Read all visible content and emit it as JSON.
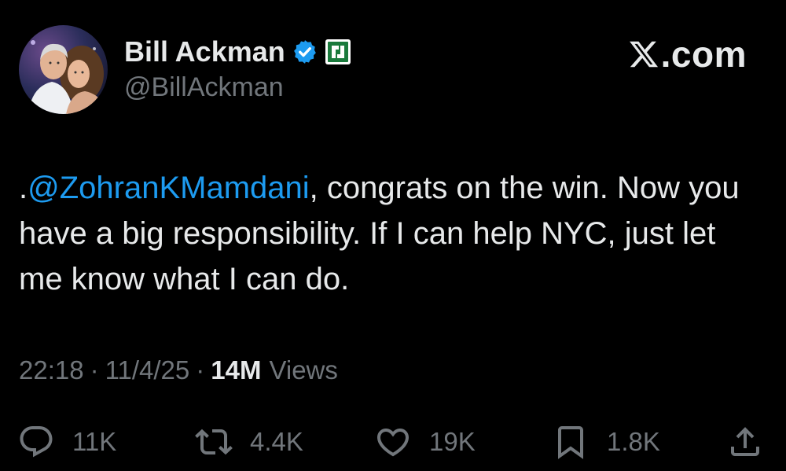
{
  "brand": {
    "label": ".com",
    "logo_icon": "x-logo-icon"
  },
  "author": {
    "display_name": "Bill Ackman",
    "handle": "@BillAckman",
    "verified_icon": "verified-badge-icon",
    "affiliation_icon": "affiliation-badge-icon",
    "verified_color": "#1d9bf0",
    "affiliation_color": "#1a7a3c"
  },
  "tweet": {
    "prefix": ".",
    "mention": "@ZohranKMamdani",
    "body": ", congrats on the win. Now you have a big responsibility. If I can help NYC, just let me know what I can do."
  },
  "meta": {
    "time": "22:18",
    "separator": "·",
    "date": "11/4/25",
    "views_count": "14M",
    "views_label": "Views"
  },
  "actions": {
    "reply": {
      "icon": "reply-icon",
      "count": "11K"
    },
    "repost": {
      "icon": "repost-icon",
      "count": "4.4K"
    },
    "like": {
      "icon": "heart-icon",
      "count": "19K"
    },
    "bookmark": {
      "icon": "bookmark-icon",
      "count": "1.8K"
    },
    "share": {
      "icon": "share-icon"
    }
  },
  "colors": {
    "background": "#000000",
    "text_primary": "#e7e9ea",
    "text_secondary": "#71767b",
    "link": "#1d9bf0"
  }
}
